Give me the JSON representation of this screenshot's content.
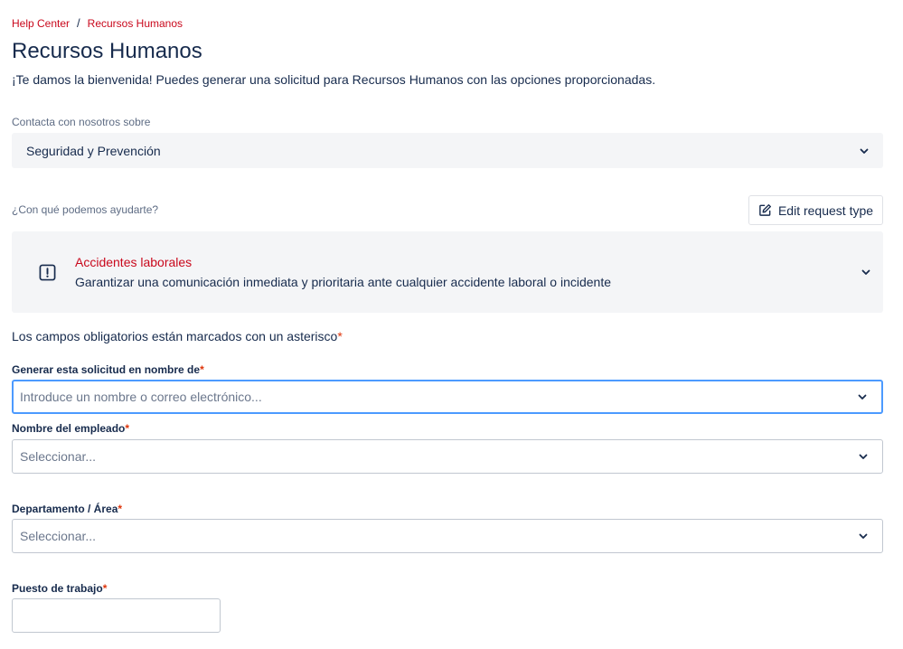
{
  "breadcrumb": {
    "home": "Help Center",
    "separator": "/",
    "current": "Recursos Humanos"
  },
  "page": {
    "title": "Recursos Humanos",
    "intro": "¡Te damos la bienvenida! Puedes generar una solicitud para Recursos Humanos con las opciones proporcionadas."
  },
  "contact": {
    "label": "Contacta con nosotros sobre",
    "selected": "Seguridad y Prevención"
  },
  "help": {
    "label": "¿Con qué podemos ayudarte?",
    "edit_button": "Edit request type"
  },
  "request_type": {
    "title": "Accidentes laborales",
    "description": "Garantizar una comunicación inmediata y prioritaria ante cualquier accidente laboral o incidente",
    "icon": "alert-icon"
  },
  "form": {
    "required_note": "Los campos obligatorios están marcados con un asterisco",
    "asterisk": "*",
    "fields": {
      "on_behalf": {
        "label": "Generar esta solicitud en nombre de",
        "placeholder": "Introduce un nombre o correo electrónico..."
      },
      "employee": {
        "label": "Nombre del empleado",
        "placeholder": "Seleccionar..."
      },
      "department": {
        "label": "Departamento / Área",
        "placeholder": "Seleccionar..."
      },
      "position": {
        "label": "Puesto de trabajo",
        "value": ""
      }
    }
  },
  "colors": {
    "link": "#c9081c",
    "text": "#172b4d",
    "focus": "#4c9aff",
    "panel": "#f4f5f7"
  }
}
